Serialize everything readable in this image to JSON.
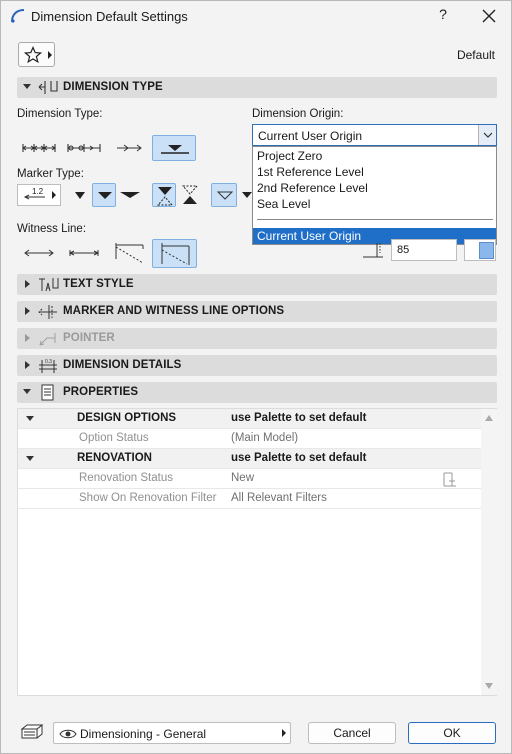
{
  "window": {
    "title": "Dimension Default Settings",
    "help": "?",
    "default_label": "Default"
  },
  "sections": {
    "dimension_type": "DIMENSION TYPE",
    "text_style": "TEXT STYLE",
    "marker_witness": "MARKER AND WITNESS LINE OPTIONS",
    "pointer": "POINTER",
    "dimension_details": "DIMENSION DETAILS",
    "properties": "PROPERTIES"
  },
  "labels": {
    "dimension_type": "Dimension Type:",
    "dimension_origin": "Dimension Origin:",
    "marker_type": "Marker Type:",
    "witness_line": "Witness Line:"
  },
  "origin": {
    "selected": "Current User Origin",
    "options": [
      "Project Zero",
      "1st Reference Level",
      "2nd Reference Level",
      "Sea Level"
    ],
    "highlighted": "Current User Origin"
  },
  "marker_size": "1.2",
  "witness_value": "85",
  "properties": {
    "rows": [
      {
        "name": "DESIGN OPTIONS",
        "value": "use Palette to set default",
        "group": true
      },
      {
        "name": "Option Status",
        "value": "(Main Model)",
        "group": false
      },
      {
        "name": "RENOVATION",
        "value": "use Palette to set default",
        "group": true
      },
      {
        "name": "Renovation Status",
        "value": "New",
        "group": false
      },
      {
        "name": "Show On Renovation Filter",
        "value": "All Relevant Filters",
        "group": false
      }
    ]
  },
  "footer": {
    "view": "Dimensioning - General",
    "cancel": "Cancel",
    "ok": "OK"
  },
  "colors": {
    "accent": "#1f6fc9",
    "selected_bg": "#c9e0f7",
    "section_bg": "#dcdcdc"
  }
}
